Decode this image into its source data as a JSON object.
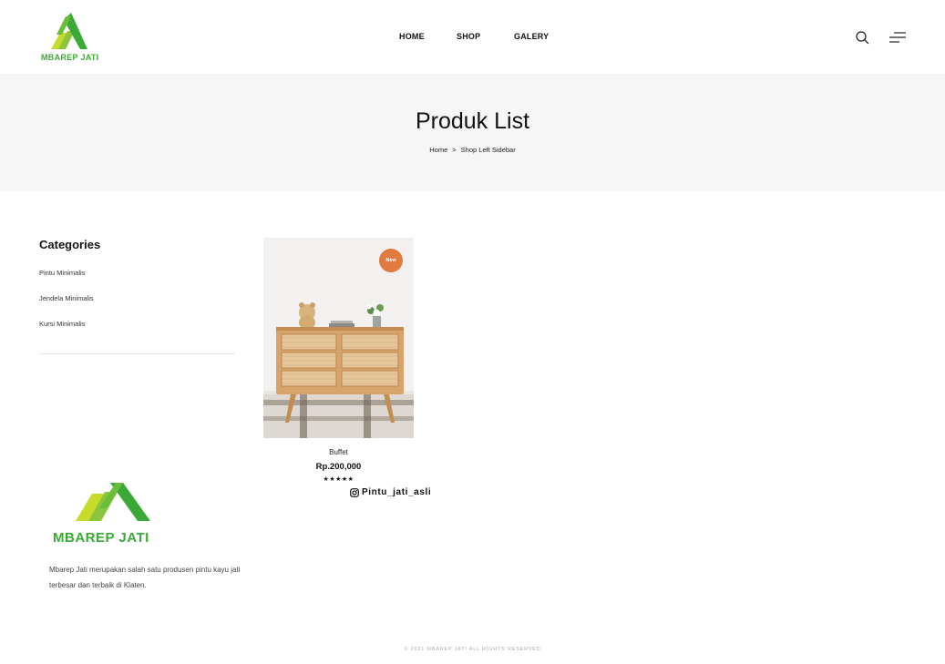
{
  "header": {
    "logo_text": "MBAREP JATI",
    "nav": [
      "HOME",
      "SHOP",
      "GALERY"
    ],
    "icons": {
      "search": "search-icon",
      "menu": "menu-lines-icon"
    }
  },
  "banner": {
    "title": "Produk List",
    "breadcrumb": [
      "Home",
      ">",
      "Shop Left Sidebar"
    ]
  },
  "sidebar": {
    "title": "Categories",
    "items": [
      "Pintu Minimalis",
      "Jendela Minimalis",
      "Kursi Minimalis"
    ]
  },
  "products": [
    {
      "badge": "New",
      "name": "Buffet",
      "price": "Rp.200,000",
      "rating": "★★★★★",
      "rating_value": 5
    }
  ],
  "instagram": {
    "handle": "Pintu_jati_asli",
    "icon": "instagram-icon"
  },
  "footer": {
    "logo_text": "MBAREP JATI",
    "description": "Mbarep Jati merupakan salah satu produsen pintu kayu jati terbesar dan terbaik di Klaten.",
    "copyright": "© 2021 MBAREP JATI ALL RIGHTS RESERVED"
  },
  "colors": {
    "brand_green": "#3aa935",
    "brand_lime": "#c6dc2a",
    "badge_orange": "#e07a3f",
    "banner_bg": "#f6f6f6"
  }
}
